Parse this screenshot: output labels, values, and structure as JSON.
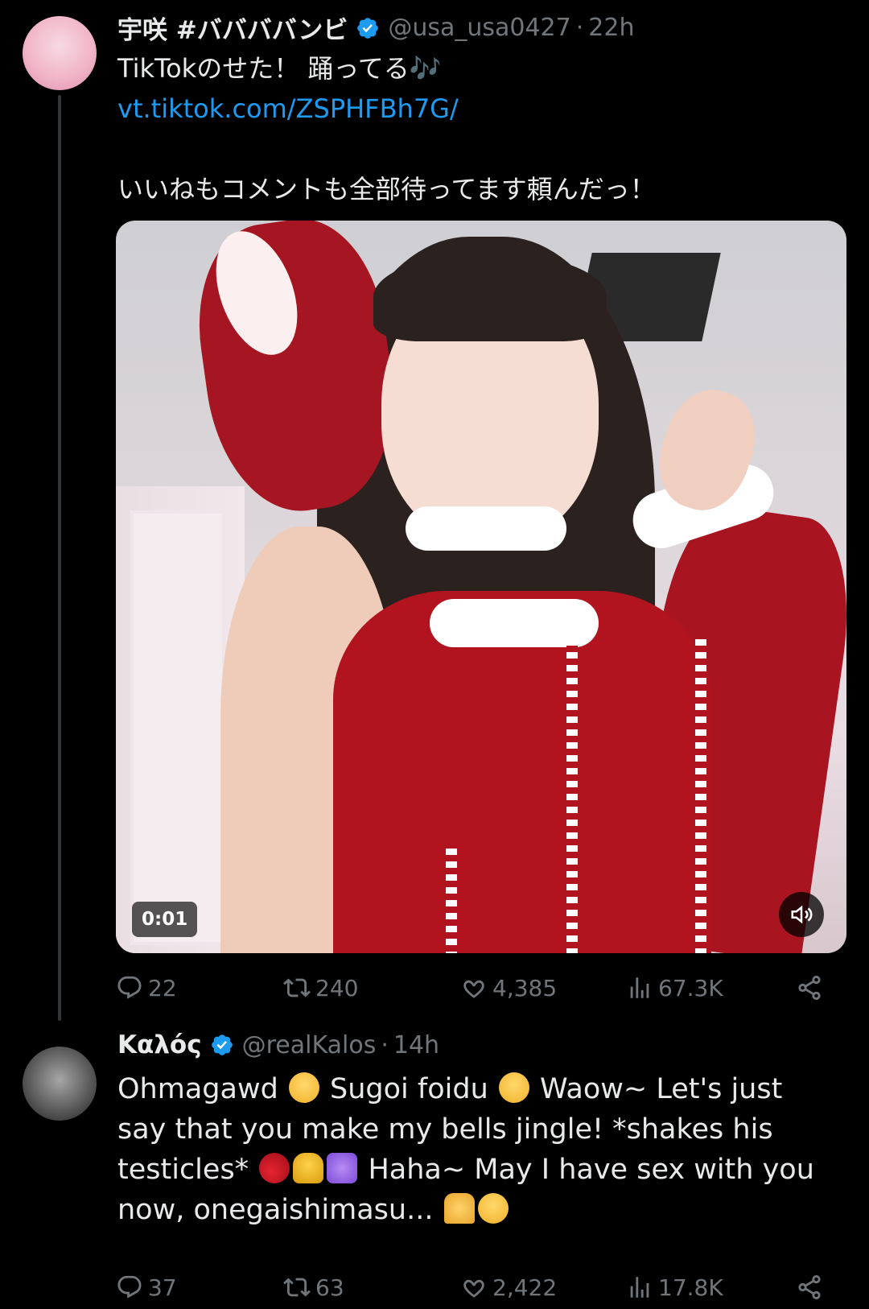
{
  "tweets": [
    {
      "display_name": "宇咲 #ババババンビ",
      "handle": "@usa_usa0427",
      "separator": "·",
      "time": "22h",
      "line1": "TikTokのせた！ 踊ってる🎶",
      "link": "vt.tiktok.com/ZSPHFBh7G/",
      "line3": "いいねもコメントも全部待ってます頼んだっ！",
      "media": {
        "duration": "0:01",
        "sound": "muted"
      },
      "stats": {
        "replies": "22",
        "retweets": "240",
        "likes": "4,385",
        "views": "67.3K"
      }
    },
    {
      "display_name": "Καλός",
      "handle": "@realKalos",
      "separator": "·",
      "time": "14h",
      "text_parts": [
        "Ohmagawd ",
        " Sugoi foidu ",
        " Waow~ Let's just say that you make my bells jingle! *shakes his testicles* ",
        " Haha~ May I have sex with you now, onegaishimasu... "
      ],
      "emojis": [
        "flushed-face",
        "heart-eyes",
        "cherries",
        "bell",
        "musical-notes",
        "folded-hands",
        "relieved-face"
      ],
      "stats": {
        "replies": "37",
        "retweets": "63",
        "likes": "2,422",
        "views": "17.8K"
      }
    }
  ],
  "colors": {
    "background": "#000000",
    "text": "#e7e9ea",
    "muted": "#71767b",
    "link": "#1d9bf0",
    "verified": "#1d9bf0"
  },
  "icons": [
    "reply-icon",
    "retweet-icon",
    "like-icon",
    "views-icon",
    "share-icon",
    "verified-badge-icon",
    "volume-muted-icon"
  ]
}
